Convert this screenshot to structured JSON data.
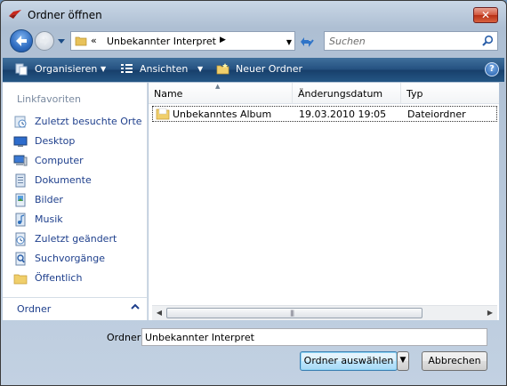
{
  "window": {
    "title": "Ordner öffnen",
    "close_glyph": "✕"
  },
  "nav": {
    "address_chevron": "«",
    "address_path": "Unbekannter Interpret",
    "search_placeholder": "Suchen"
  },
  "toolbar": {
    "organize": "Organisieren",
    "views": "Ansichten",
    "new_folder": "Neuer Ordner",
    "help": "?"
  },
  "sidebar": {
    "header": "Linkfavoriten",
    "items": [
      {
        "label": "Zuletzt besuchte Orte",
        "icon": "recent-places-icon"
      },
      {
        "label": "Desktop",
        "icon": "desktop-icon"
      },
      {
        "label": "Computer",
        "icon": "computer-icon"
      },
      {
        "label": "Dokumente",
        "icon": "documents-icon"
      },
      {
        "label": "Bilder",
        "icon": "pictures-icon"
      },
      {
        "label": "Musik",
        "icon": "music-icon"
      },
      {
        "label": "Zuletzt geändert",
        "icon": "recently-changed-icon"
      },
      {
        "label": "Suchvorgänge",
        "icon": "searches-icon"
      },
      {
        "label": "Öffentlich",
        "icon": "public-folder-icon"
      }
    ],
    "footer": "Ordner"
  },
  "filelist": {
    "columns": [
      "Name",
      "Änderungsdatum",
      "Typ"
    ],
    "rows": [
      {
        "name": "Unbekanntes Album",
        "date": "19.03.2010 19:05",
        "type": "Dateiordner"
      }
    ]
  },
  "bottom": {
    "folder_label": "Ordner:",
    "folder_value": "Unbekannter Interpret",
    "select_button": "Ordner auswählen",
    "cancel_button": "Abbrechen"
  },
  "colors": {
    "toolbar": "#24507f",
    "link": "#1e3f8c",
    "close": "#c7432a"
  }
}
